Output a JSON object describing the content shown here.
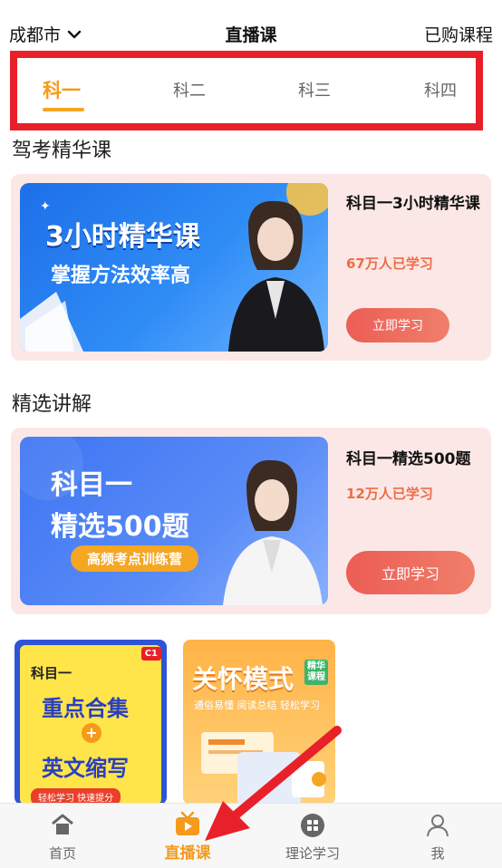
{
  "header": {
    "city": "成都市",
    "title": "直播课",
    "purchased": "已购课程"
  },
  "tabs": [
    {
      "label": "科一",
      "active": true
    },
    {
      "label": "科二",
      "active": false
    },
    {
      "label": "科三",
      "active": false
    },
    {
      "label": "科四",
      "active": false
    }
  ],
  "sections": [
    {
      "title": "驾考精华课",
      "card": {
        "banner_line1": "3小时精华课",
        "banner_line2": "掌握方法效率高",
        "course_title": "科目一3小时精华课",
        "learners": "67万人已学习",
        "cta": "立即学习"
      }
    },
    {
      "title": "精选讲解",
      "card": {
        "banner_line1": "科目一",
        "banner_line2": "精选500题",
        "banner_tag": "高频考点训练营",
        "course_title": "科目一精选500题",
        "learners": "12万人已学习",
        "cta": "立即学习"
      }
    }
  ],
  "thumbs": [
    {
      "badge": "C1",
      "top": "科目一",
      "line1": "重点合集",
      "plus": "+",
      "line2": "英文缩写",
      "foot": "轻松学习 快速提分"
    },
    {
      "title": "关怀模式",
      "badge": "精华课程",
      "sub": "通俗易懂 阅读总结 轻松学习"
    }
  ],
  "bottom_nav": [
    {
      "label": "首页",
      "icon": "home-icon",
      "active": false
    },
    {
      "label": "直播课",
      "icon": "tv-play-icon",
      "active": true
    },
    {
      "label": "理论学习",
      "icon": "grid-icon",
      "active": false
    },
    {
      "label": "我",
      "icon": "person-icon",
      "active": false
    }
  ],
  "colors": {
    "accent": "#f59a1b",
    "highlight": "#e8202a",
    "cta": "#ec5d55",
    "card_bg": "#fbe8e6"
  }
}
